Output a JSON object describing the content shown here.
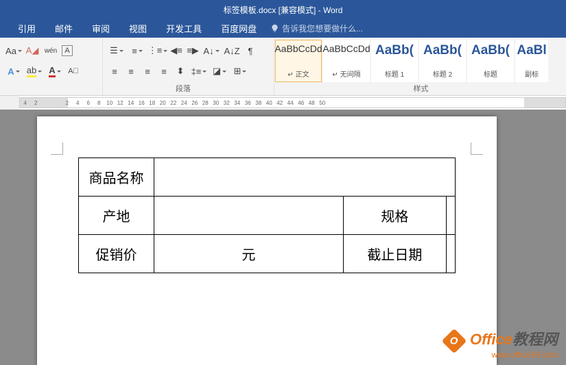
{
  "title": "标签模板.docx [兼容模式] - Word",
  "menu": {
    "items": [
      "引用",
      "邮件",
      "审阅",
      "视图",
      "开发工具",
      "百度网盘"
    ],
    "tell_me": "告诉我您想要做什么..."
  },
  "ribbon": {
    "font_group_label": "",
    "paragraph_label": "段落",
    "styles_label": "样式",
    "font_case": "Aa",
    "wen": "wén",
    "a_enclosed": "A",
    "styles": [
      {
        "preview": "AaBbCcDd",
        "name": "↵ 正文",
        "selected": true,
        "big": false
      },
      {
        "preview": "AaBbCcDd",
        "name": "↵ 无间隔",
        "selected": false,
        "big": false
      },
      {
        "preview": "AaBb(",
        "name": "标题 1",
        "selected": false,
        "big": true
      },
      {
        "preview": "AaBb(",
        "name": "标题 2",
        "selected": false,
        "big": true
      },
      {
        "preview": "AaBb(",
        "name": "标题",
        "selected": false,
        "big": true
      },
      {
        "preview": "AaBl",
        "name": "副标",
        "selected": false,
        "big": true
      }
    ]
  },
  "ruler": {
    "left_nums": [
      "4",
      "2"
    ],
    "right_nums": [
      "2",
      "4",
      "6",
      "8",
      "10",
      "12",
      "14",
      "16",
      "18",
      "20",
      "22",
      "24",
      "26",
      "28",
      "30",
      "32",
      "34",
      "36",
      "38",
      "40",
      "42",
      "44",
      "46",
      "48",
      "50"
    ]
  },
  "table": {
    "r1c1": "商品名称",
    "r2c1": "产地",
    "r2c3": "规格",
    "r3c1": "促销价",
    "r3c2": "元",
    "r3c3": "截止日期"
  },
  "watermark": {
    "brand": "Office",
    "brand2": "教程网",
    "url": "www.office26.com",
    "badge": "O"
  }
}
